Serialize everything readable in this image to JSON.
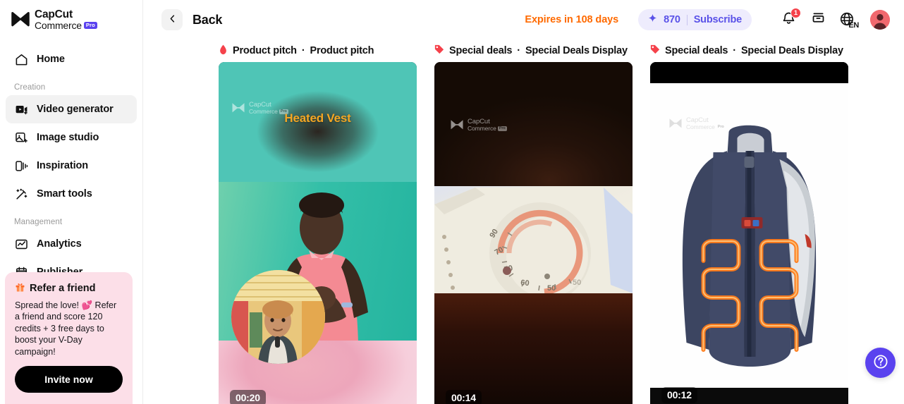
{
  "brand": {
    "name_line1": "CapCut",
    "name_line2": "Commerce",
    "pro_badge": "Pro"
  },
  "sidebar": {
    "home": {
      "label": "Home",
      "icon": "home-icon"
    },
    "sections": [
      {
        "title": "Creation",
        "items": [
          {
            "label": "Video generator",
            "icon": "video-generator-icon",
            "active": true
          },
          {
            "label": "Image studio",
            "icon": "image-studio-icon",
            "active": false
          },
          {
            "label": "Inspiration",
            "icon": "inspiration-icon",
            "active": false
          },
          {
            "label": "Smart tools",
            "icon": "smart-tools-icon",
            "active": false
          }
        ]
      },
      {
        "title": "Management",
        "items": [
          {
            "label": "Analytics",
            "icon": "analytics-icon",
            "active": false
          },
          {
            "label": "Publisher",
            "icon": "publisher-icon",
            "active": false
          }
        ]
      }
    ],
    "refer_card": {
      "icon": "gift-icon",
      "title": "Refer a friend",
      "body": "Spread the love! 💕 Refer a friend and score 120 credits + 3 free days to boost your V-Day campaign!",
      "button_label": "Invite now",
      "bg_color": "#fcdfe8"
    }
  },
  "topbar": {
    "back_label": "Back",
    "back_icon": "chevron-left-icon",
    "expires_text": "Expires in 108 days",
    "expires_color": "#ff6a00",
    "credits": {
      "icon": "sparkle-icon",
      "value": "870",
      "subscribe_label": "Subscribe",
      "accent_color": "#5a52e8",
      "bg_color": "#eeecfd"
    },
    "notifications": {
      "icon": "bell-icon",
      "badge": "1",
      "badge_color": "#f5424b"
    },
    "archive": {
      "icon": "stack-icon"
    },
    "language": {
      "icon": "globe-icon",
      "code": "EN"
    },
    "avatar": {
      "icon": "avatar-icon"
    }
  },
  "cards": [
    {
      "category": "Product pitch",
      "separator": "·",
      "template": "Product pitch",
      "icon": "flame-icon",
      "icon_color": "#f5424b",
      "duration": "00:20",
      "overlay_title": "Heated Vest",
      "overlay_title_color": "#f5a623",
      "watermark_line1": "CapCut",
      "watermark_line2": "Commerce",
      "watermark_badge": "Pro"
    },
    {
      "category": "Special deals",
      "separator": "·",
      "template": "Special Deals Display",
      "icon": "price-tag-icon",
      "icon_color": "#f5424b",
      "duration": "00:14",
      "overlay_title": "",
      "overlay_title_color": "#f5a623",
      "watermark_line1": "CapCut",
      "watermark_line2": "Commerce",
      "watermark_badge": "Pro"
    },
    {
      "category": "Special deals",
      "separator": "·",
      "template": "Special Deals Display",
      "icon": "price-tag-icon",
      "icon_color": "#f5424b",
      "duration": "00:12",
      "overlay_title": "",
      "overlay_title_color": "#f5a623",
      "watermark_line1": "CapCut",
      "watermark_line2": "Commerce",
      "watermark_badge": "Pro"
    }
  ],
  "help": {
    "icon": "question-mark-icon",
    "color": "#5a42ef"
  }
}
